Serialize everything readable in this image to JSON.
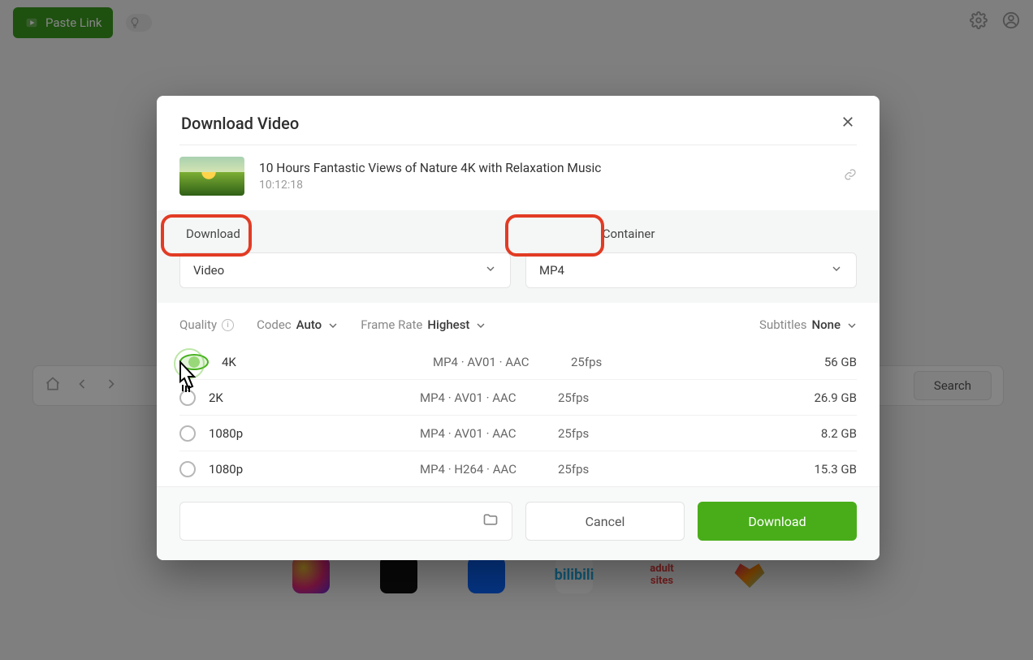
{
  "topbar": {
    "paste_label": "Paste Link"
  },
  "nav": {
    "search_label": "Search"
  },
  "modal": {
    "title": "Download Video",
    "video": {
      "title": "10 Hours Fantastic Views of Nature 4K with Relaxation Music",
      "duration": "10:12:18"
    },
    "labels": {
      "download": "Download",
      "container": "Container"
    },
    "selects": {
      "download_value": "Video",
      "container_value": "MP4"
    },
    "filters": {
      "quality_label": "Quality",
      "quality_info": "i",
      "codec_label": "Codec",
      "codec_value": "Auto",
      "fps_label": "Frame Rate",
      "fps_value": "Highest",
      "subs_label": "Subtitles",
      "subs_value": "None"
    },
    "rows": [
      {
        "name": "4K",
        "codec": "MP4 · AV01 · AAC",
        "fps": "25fps",
        "size": "56 GB",
        "selected": true
      },
      {
        "name": "2K",
        "codec": "MP4 · AV01 · AAC",
        "fps": "25fps",
        "size": "26.9 GB",
        "selected": false
      },
      {
        "name": "1080p",
        "codec": "MP4 · AV01 · AAC",
        "fps": "25fps",
        "size": "8.2 GB",
        "selected": false
      },
      {
        "name": "1080p",
        "codec": "MP4 · H264 · AAC",
        "fps": "25fps",
        "size": "15.3 GB",
        "selected": false
      }
    ],
    "footer": {
      "cancel": "Cancel",
      "download": "Download"
    }
  }
}
